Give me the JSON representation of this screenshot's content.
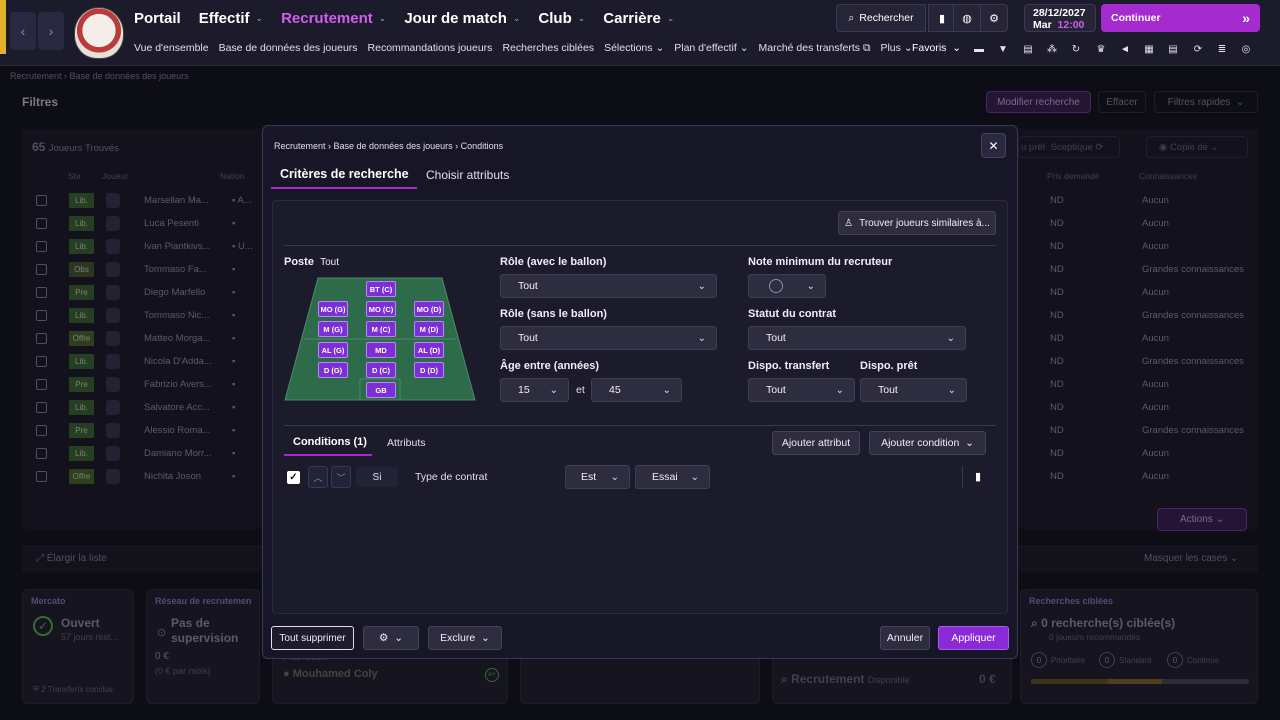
{
  "header": {
    "main_nav": [
      {
        "label": "Portail",
        "active": false
      },
      {
        "label": "Effectif",
        "active": false
      },
      {
        "label": "Recrutement",
        "active": true
      },
      {
        "label": "Jour de match",
        "active": false
      },
      {
        "label": "Club",
        "active": false
      },
      {
        "label": "Carrière",
        "active": false
      }
    ],
    "sub_nav": [
      "Vue d'ensemble",
      "Base de données des joueurs",
      "Recommandations joueurs",
      "Recherches ciblées",
      "Sélections",
      "Plan d'effectif",
      "Marché des transferts",
      "Plus"
    ],
    "search_label": "Rechercher",
    "date": "28/12/2027",
    "day": "Mar",
    "time": "12:00",
    "continue_label": "Continuer",
    "favorites_label": "Favoris"
  },
  "breadcrumb": [
    "Recrutement",
    "Base de données des joueurs"
  ],
  "filters": {
    "title": "Filtres",
    "modify_search": "Modifier recherche",
    "clear": "Effacer",
    "quick_filters": "Filtres rapides"
  },
  "players_panel": {
    "count": "65",
    "found_label": "Joueurs Trouvés",
    "headers": {
      "status": "Sta",
      "player": "Joueur",
      "nation": "Nation",
      "asking_price": "Prix demandé",
      "knowledge": "Connaissances"
    },
    "attitude_fragment": "u prêt",
    "attitude_value": "Sceptique",
    "copy_label": "Copie de",
    "actions_label": "Actions",
    "expand_list": "Élargir la liste",
    "hide_boxes": "Masquer les cases",
    "rows": [
      {
        "status": "Lib.",
        "name": "Marsellan Ma...",
        "nation_fragment": "A...",
        "price": "ND",
        "knowledge": "Aucun"
      },
      {
        "status": "Lib.",
        "name": "Luca Pesenti",
        "nation_fragment": "",
        "price": "ND",
        "knowledge": "Aucun"
      },
      {
        "status": "Lib.",
        "name": "Ivan Piantkivs...",
        "nation_fragment": "U...",
        "price": "ND",
        "knowledge": "Aucun"
      },
      {
        "status": "Obs",
        "name": "Tommaso Fa...",
        "nation_fragment": "",
        "price": "ND",
        "knowledge": "Grandes connaissances"
      },
      {
        "status": "Pre",
        "name": "Diego Marfello",
        "nation_fragment": "",
        "price": "ND",
        "knowledge": "Aucun"
      },
      {
        "status": "Lib.",
        "name": "Tommaso Nic...",
        "nation_fragment": "",
        "price": "ND",
        "knowledge": "Grandes connaissances"
      },
      {
        "status": "Offre",
        "name": "Matteo Morga...",
        "nation_fragment": "",
        "price": "ND",
        "knowledge": "Aucun"
      },
      {
        "status": "Lib.",
        "name": "Nicola D'Adda...",
        "nation_fragment": "",
        "price": "ND",
        "knowledge": "Grandes connaissances"
      },
      {
        "status": "Pre",
        "name": "Fabrizio Avers...",
        "nation_fragment": "",
        "price": "ND",
        "knowledge": "Aucun"
      },
      {
        "status": "Lib.",
        "name": "Salvatore Acc...",
        "nation_fragment": "",
        "price": "ND",
        "knowledge": "Aucun"
      },
      {
        "status": "Pre",
        "name": "Alessio Roma...",
        "nation_fragment": "",
        "price": "ND",
        "knowledge": "Grandes connaissances"
      },
      {
        "status": "Lib.",
        "name": "Damiano Morr...",
        "nation_fragment": "",
        "price": "ND",
        "knowledge": "Aucun"
      },
      {
        "status": "Offre",
        "name": "Nichita Joson",
        "nation_fragment": "",
        "price": "ND",
        "knowledge": "Aucun"
      }
    ]
  },
  "cards": {
    "mercato": {
      "title": "Mercato",
      "state": "Ouvert",
      "remaining": "57 jours rest...",
      "transfers": "2  Transferts conclus"
    },
    "network": {
      "title": "Réseau de recrutemen",
      "label": "Pas de supervision",
      "cost": "0 €",
      "cost_month": "(0 € par mois)"
    },
    "player": {
      "fragment": "Plus récent",
      "name": "Mouhamed Coly",
      "grade": "A+"
    },
    "recruitment": {
      "label": "Recrutement",
      "sub": "Disponible",
      "value": "0 €"
    },
    "targeted": {
      "title": "Recherches ciblées",
      "count": "0 recherche(s) ciblée(s)",
      "recommended": "0 joueurs recommandés",
      "priority": "Prioritaire",
      "standard": "Standard",
      "continuous": "Continue",
      "circle_value": "0"
    }
  },
  "modal": {
    "breadcrumb": [
      "Recrutement",
      "Base de données des joueurs",
      "Conditions"
    ],
    "tabs": [
      "Critères de recherche",
      "Choisir attributs"
    ],
    "similar_btn": "Trouver joueurs similaires à...",
    "poste_label": "Poste",
    "poste_value": "Tout",
    "positions": [
      "BT (C)",
      "MO (G)",
      "MO (C)",
      "MO (D)",
      "M (G)",
      "M (C)",
      "M (D)",
      "AL (G)",
      "MD",
      "AL (D)",
      "D (G)",
      "D (C)",
      "D (D)",
      "GB"
    ],
    "role_ball_label": "Rôle (avec le ballon)",
    "role_ball_value": "Tout",
    "role_noball_label": "Rôle (sans le ballon)",
    "role_noball_value": "Tout",
    "age_label": "Âge entre (années)",
    "age_min": "15",
    "age_and": "et",
    "age_max": "45",
    "min_rating_label": "Note minimum du recruteur",
    "contract_label": "Statut du contrat",
    "contract_value": "Tout",
    "transfer_label": "Dispo. transfert",
    "transfer_value": "Tout",
    "loan_label": "Dispo. prêt",
    "loan_value": "Tout",
    "cond_tab": "Conditions (1)",
    "attr_tab": "Attributs",
    "add_attr": "Ajouter attribut",
    "add_cond": "Ajouter condition",
    "condition": {
      "checked": true,
      "si": "Si",
      "field": "Type de contrat",
      "op": "Est",
      "value": "Essai"
    },
    "delete_all": "Tout supprimer",
    "exclude": "Exclure",
    "cancel": "Annuler",
    "apply": "Appliquer"
  },
  "colors": {
    "accent": "#a52ad0",
    "active_nav": "#d25cf0",
    "position_chip": "#7d2fd6",
    "pitch": "#2e6b4a",
    "status_green": "#3e6a34"
  }
}
